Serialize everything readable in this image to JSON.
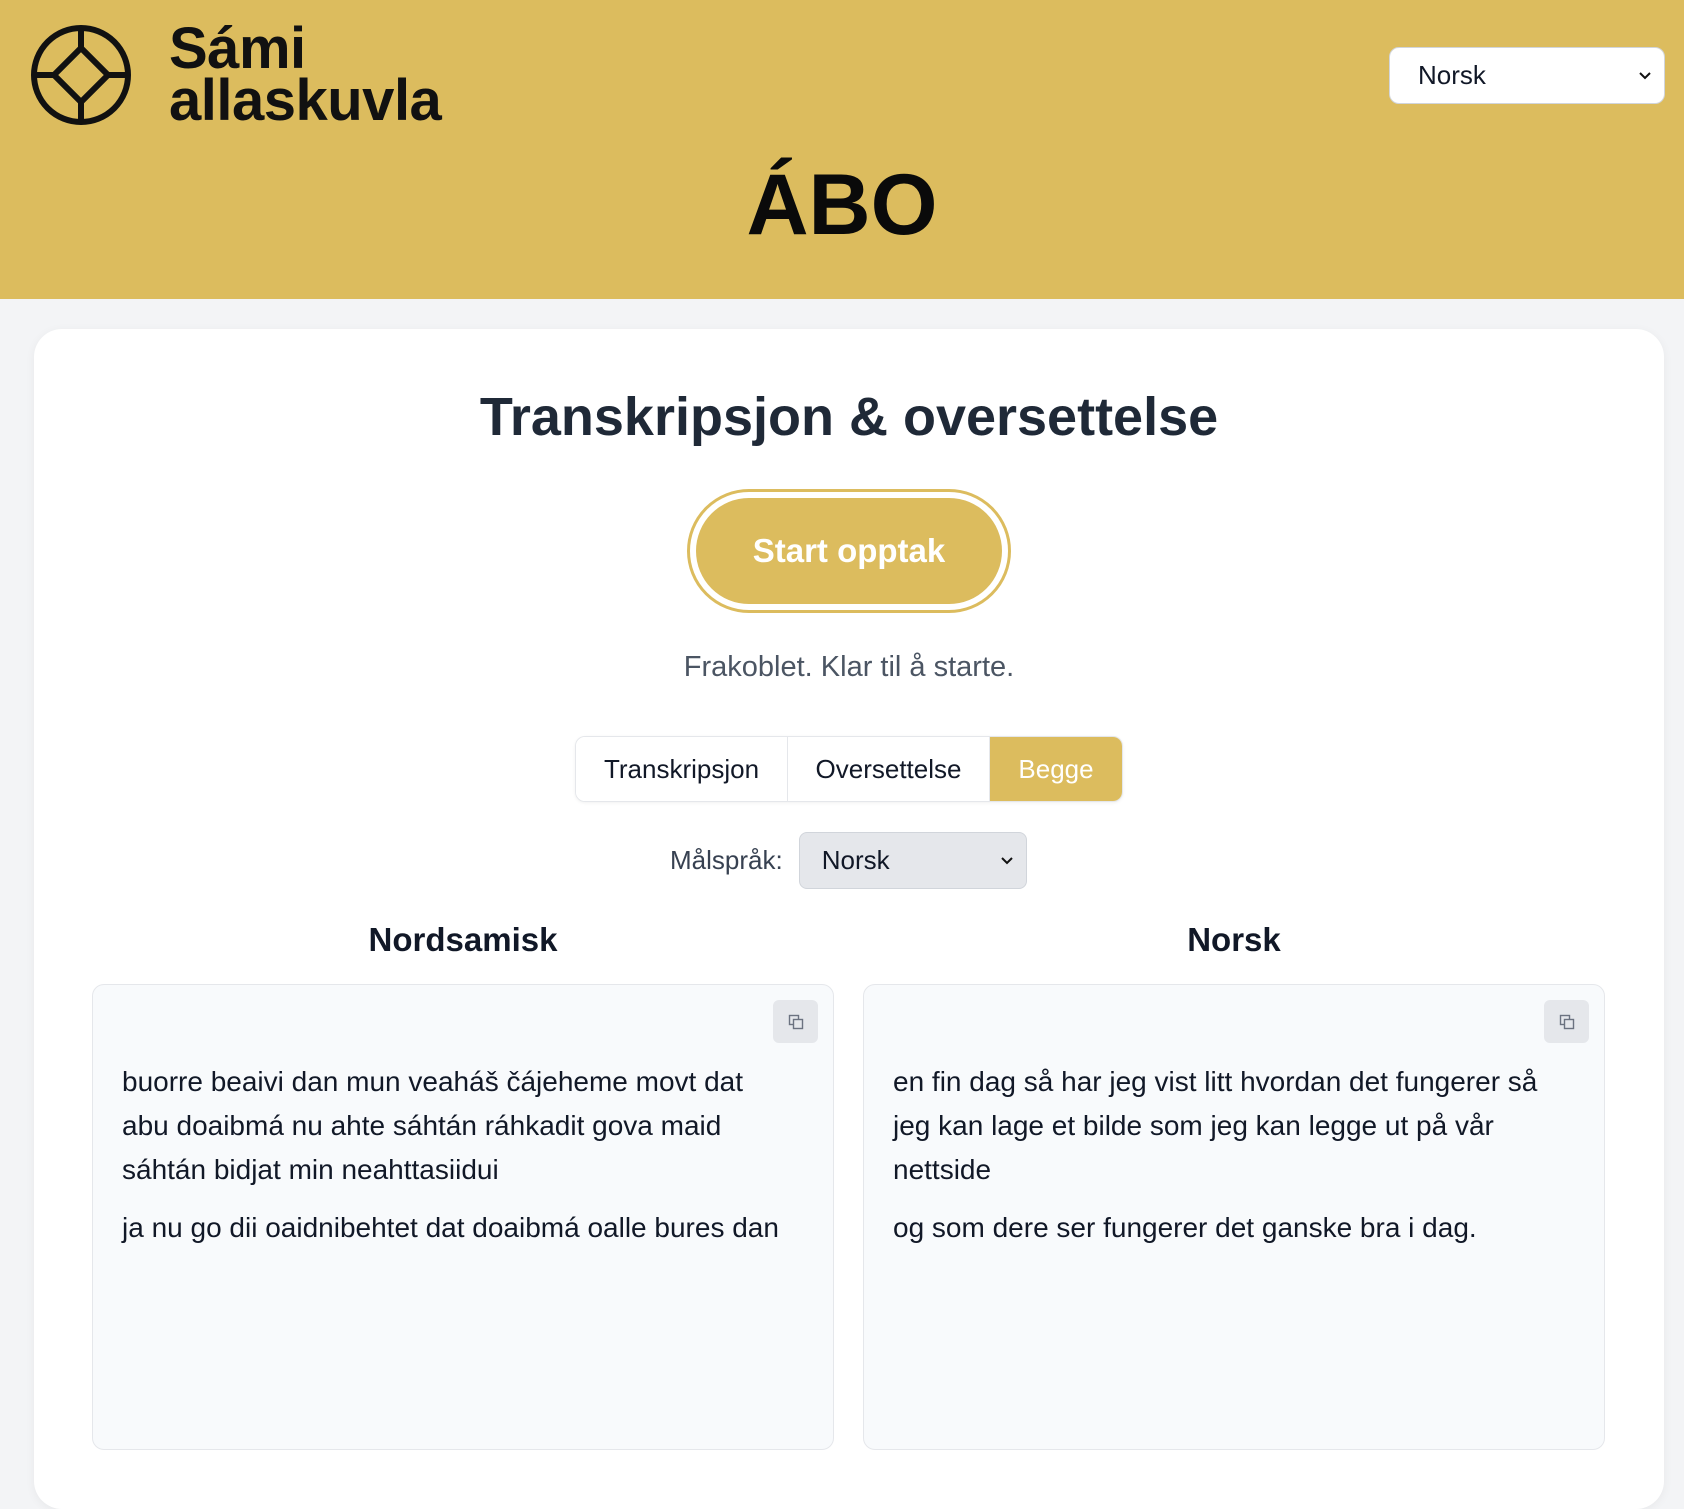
{
  "header": {
    "logo_line1": "Sámi",
    "logo_line2": "allaskuvla",
    "logo_icon": "sami-allaskuvla-logo-icon",
    "language_selected": "Norsk",
    "app_title": "ÁBO"
  },
  "main": {
    "title": "Transkripsjon & oversettelse",
    "record_button": "Start opptak",
    "status": "Frakoblet. Klar til å starte.",
    "modes": [
      {
        "label": "Transkripsjon",
        "active": false
      },
      {
        "label": "Oversettelse",
        "active": false
      },
      {
        "label": "Begge",
        "active": true
      }
    ],
    "target_language_label": "Målspråk:",
    "target_language_selected": "Norsk",
    "source": {
      "heading": "Nordsamisk",
      "copy_icon": "copy-icon",
      "paragraphs": [
        "buorre beaivi dan mun veaháš čájeheme movt dat abu doaibmá nu ahte sáhtán ráhkadit gova maid sáhtán bidjat min neahttasiidui",
        "ja nu go dii oaidnibehtet dat doaibmá oalle bures dan"
      ]
    },
    "target": {
      "heading": "Norsk",
      "copy_icon": "copy-icon",
      "paragraphs": [
        "en fin dag så har jeg vist litt hvordan det fungerer så jeg kan lage et bilde som jeg kan legge ut på vår nettside",
        "og som dere ser fungerer det ganske bra i dag."
      ]
    }
  },
  "colors": {
    "brand_gold": "#dcbc5e",
    "page_bg": "#f3f4f6",
    "panel_bg": "#f8fafc"
  }
}
